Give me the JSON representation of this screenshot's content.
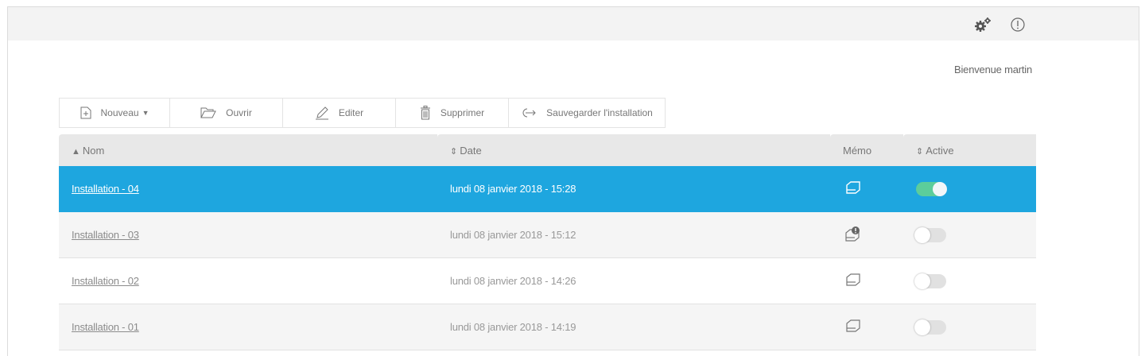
{
  "header": {
    "settings_icon": "gears-icon",
    "info_icon": "info-icon"
  },
  "welcome": "Bienvenue martin",
  "toolbar": {
    "new_label": "Nouveau",
    "open_label": "Ouvrir",
    "edit_label": "Editer",
    "delete_label": "Supprimer",
    "save_label": "Sauvegarder l'installation"
  },
  "table": {
    "columns": {
      "name": "Nom",
      "date": "Date",
      "memo": "Mémo",
      "active": "Active"
    },
    "rows": [
      {
        "name": "Installation - 04",
        "date": "lundi 08 janvier 2018 - 15:28",
        "memo_alert": false,
        "active": true,
        "selected": true
      },
      {
        "name": "Installation - 03",
        "date": "lundi 08 janvier 2018 - 15:12",
        "memo_alert": true,
        "active": false,
        "selected": false
      },
      {
        "name": "Installation - 02",
        "date": "lundi 08 janvier 2018 - 14:26",
        "memo_alert": false,
        "active": false,
        "selected": false
      },
      {
        "name": "Installation - 01",
        "date": "lundi 08 janvier 2018 - 14:19",
        "memo_alert": false,
        "active": false,
        "selected": false
      }
    ]
  },
  "colors": {
    "selected_row": "#1ea6df",
    "toggle_on": "#5ccd9b",
    "toggle_off": "#e1e1e1"
  }
}
